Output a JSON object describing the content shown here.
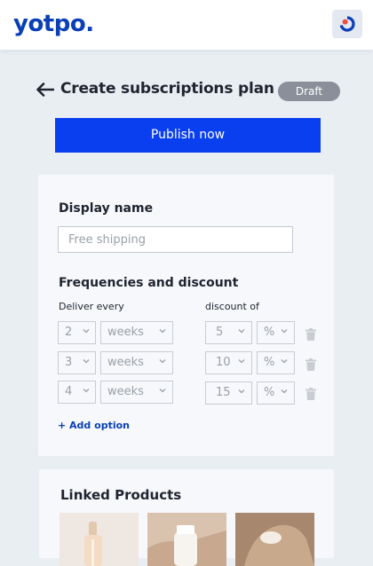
{
  "brand": {
    "logo_text": "yotpo.",
    "logo_color": "#0a3fb8",
    "app_icon": "yotpo-subscriptions-icon"
  },
  "header": {
    "title": "Create subscriptions plan",
    "status": "Draft",
    "back_icon": "arrow-left-icon"
  },
  "actions": {
    "publish_label": "Publish now",
    "publish_color": "#0a3ff0"
  },
  "display_name": {
    "section_title": "Display name",
    "placeholder": "Free shipping"
  },
  "frequencies": {
    "section_title": "Frequencies and discount",
    "deliver_label": "Deliver every",
    "discount_label": "discount of",
    "rows": [
      {
        "interval": "2",
        "unit": "weeks",
        "discount": "5",
        "discount_type": "%"
      },
      {
        "interval": "3",
        "unit": "weeks",
        "discount": "10",
        "discount_type": "%"
      },
      {
        "interval": "4",
        "unit": "weeks",
        "discount": "15",
        "discount_type": "%"
      }
    ],
    "add_option_label": "+ Add option"
  },
  "linked_products": {
    "section_title": "Linked Products",
    "thumbnails": [
      "dropper-bottle-image",
      "cream-jar-image",
      "hand-cream-image"
    ]
  }
}
